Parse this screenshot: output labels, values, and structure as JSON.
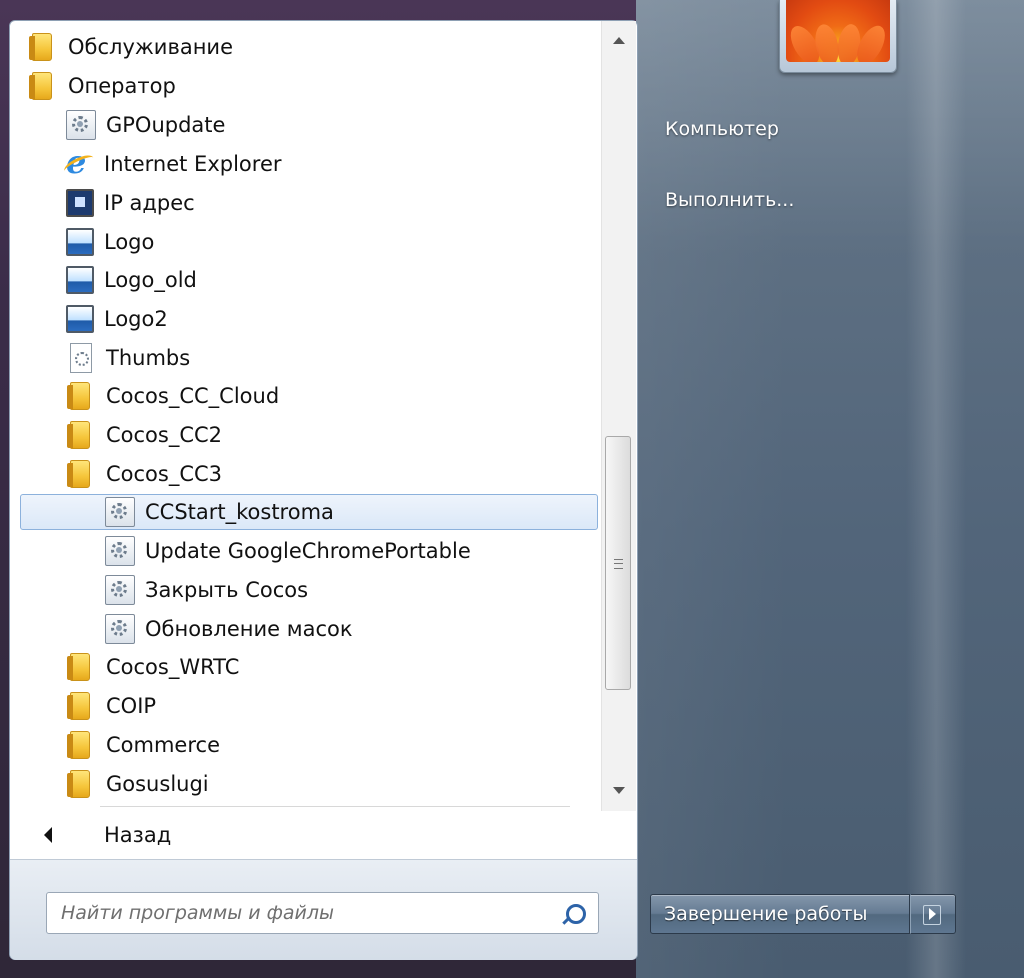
{
  "programs": {
    "items": [
      {
        "label": "Обслуживание",
        "icon": "folder-icon"
      },
      {
        "label": "Оператор",
        "icon": "folder-icon"
      },
      {
        "label": "GPOupdate",
        "icon": "shortcut-icon"
      },
      {
        "label": "Internet Explorer",
        "icon": "internet-explorer-icon"
      },
      {
        "label": "IP адрес",
        "icon": "monitor-icon"
      },
      {
        "label": "Logo",
        "icon": "image-icon"
      },
      {
        "label": "Logo_old",
        "icon": "image-icon"
      },
      {
        "label": "Logo2",
        "icon": "image-icon"
      },
      {
        "label": "Thumbs",
        "icon": "file-icon"
      },
      {
        "label": "Cocos_CC_Cloud",
        "icon": "folder-icon"
      },
      {
        "label": "Cocos_CC2",
        "icon": "folder-icon"
      },
      {
        "label": "Cocos_CC3",
        "icon": "folder-icon"
      },
      {
        "label": "CCStart_kostroma",
        "icon": "shortcut-icon",
        "selected": true
      },
      {
        "label": "Update GoogleChromePortable",
        "icon": "shortcut-icon"
      },
      {
        "label": "Закрыть Cocos",
        "icon": "shortcut-icon"
      },
      {
        "label": "Обновление масок",
        "icon": "shortcut-icon"
      },
      {
        "label": "Cocos_WRTC",
        "icon": "folder-icon"
      },
      {
        "label": "COIP",
        "icon": "folder-icon"
      },
      {
        "label": "Commerce",
        "icon": "folder-icon"
      },
      {
        "label": "Gosuslugi",
        "icon": "folder-icon"
      }
    ],
    "back_label": "Назад"
  },
  "search": {
    "placeholder": "Найти программы и файлы",
    "value": ""
  },
  "right_menu": {
    "computer": "Компьютер",
    "run": "Выполнить..."
  },
  "shutdown": {
    "label": "Завершение работы"
  },
  "colors": {
    "selection": "#dbe8f8",
    "selection_border": "#8cb1dc",
    "right_pane": "#5d6f82",
    "search_icon": "#2d63a8"
  }
}
